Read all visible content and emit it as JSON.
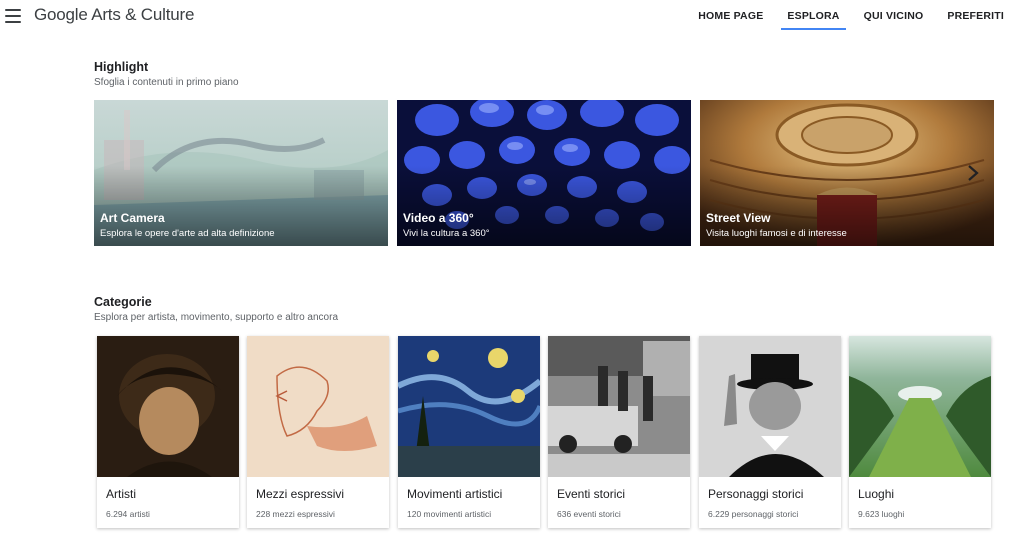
{
  "header": {
    "logo": "Google Arts & Culture",
    "nav": [
      "HOME PAGE",
      "ESPLORA",
      "QUI VICINO",
      "PREFERITI"
    ],
    "active_nav": "ESPLORA"
  },
  "highlight": {
    "title": "Highlight",
    "subtitle": "Sfoglia i contenuti in primo piano",
    "cards": [
      {
        "title": "Art Camera",
        "subtitle": "Esplora le opere d'arte ad alta definizione"
      },
      {
        "title": "Video a 360°",
        "subtitle": "Vivi la cultura a 360°"
      },
      {
        "title": "Street View",
        "subtitle": "Visita luoghi famosi e di interesse"
      }
    ]
  },
  "categories": {
    "title": "Categorie",
    "subtitle": "Esplora per artista, movimento, supporto e altro ancora",
    "cards": [
      {
        "title": "Artisti",
        "count": "6.294 artisti"
      },
      {
        "title": "Mezzi espressivi",
        "count": "228 mezzi espressivi"
      },
      {
        "title": "Movimenti artistici",
        "count": "120 movimenti artistici"
      },
      {
        "title": "Eventi storici",
        "count": "636 eventi storici"
      },
      {
        "title": "Personaggi storici",
        "count": "6.229 personaggi storici"
      },
      {
        "title": "Luoghi",
        "count": "9.623 luoghi"
      }
    ]
  },
  "colors": {
    "accent": "#4285f4",
    "text": "#202124",
    "muted": "#5f6368"
  },
  "icons": [
    "menu-icon",
    "chevron-right-icon"
  ]
}
